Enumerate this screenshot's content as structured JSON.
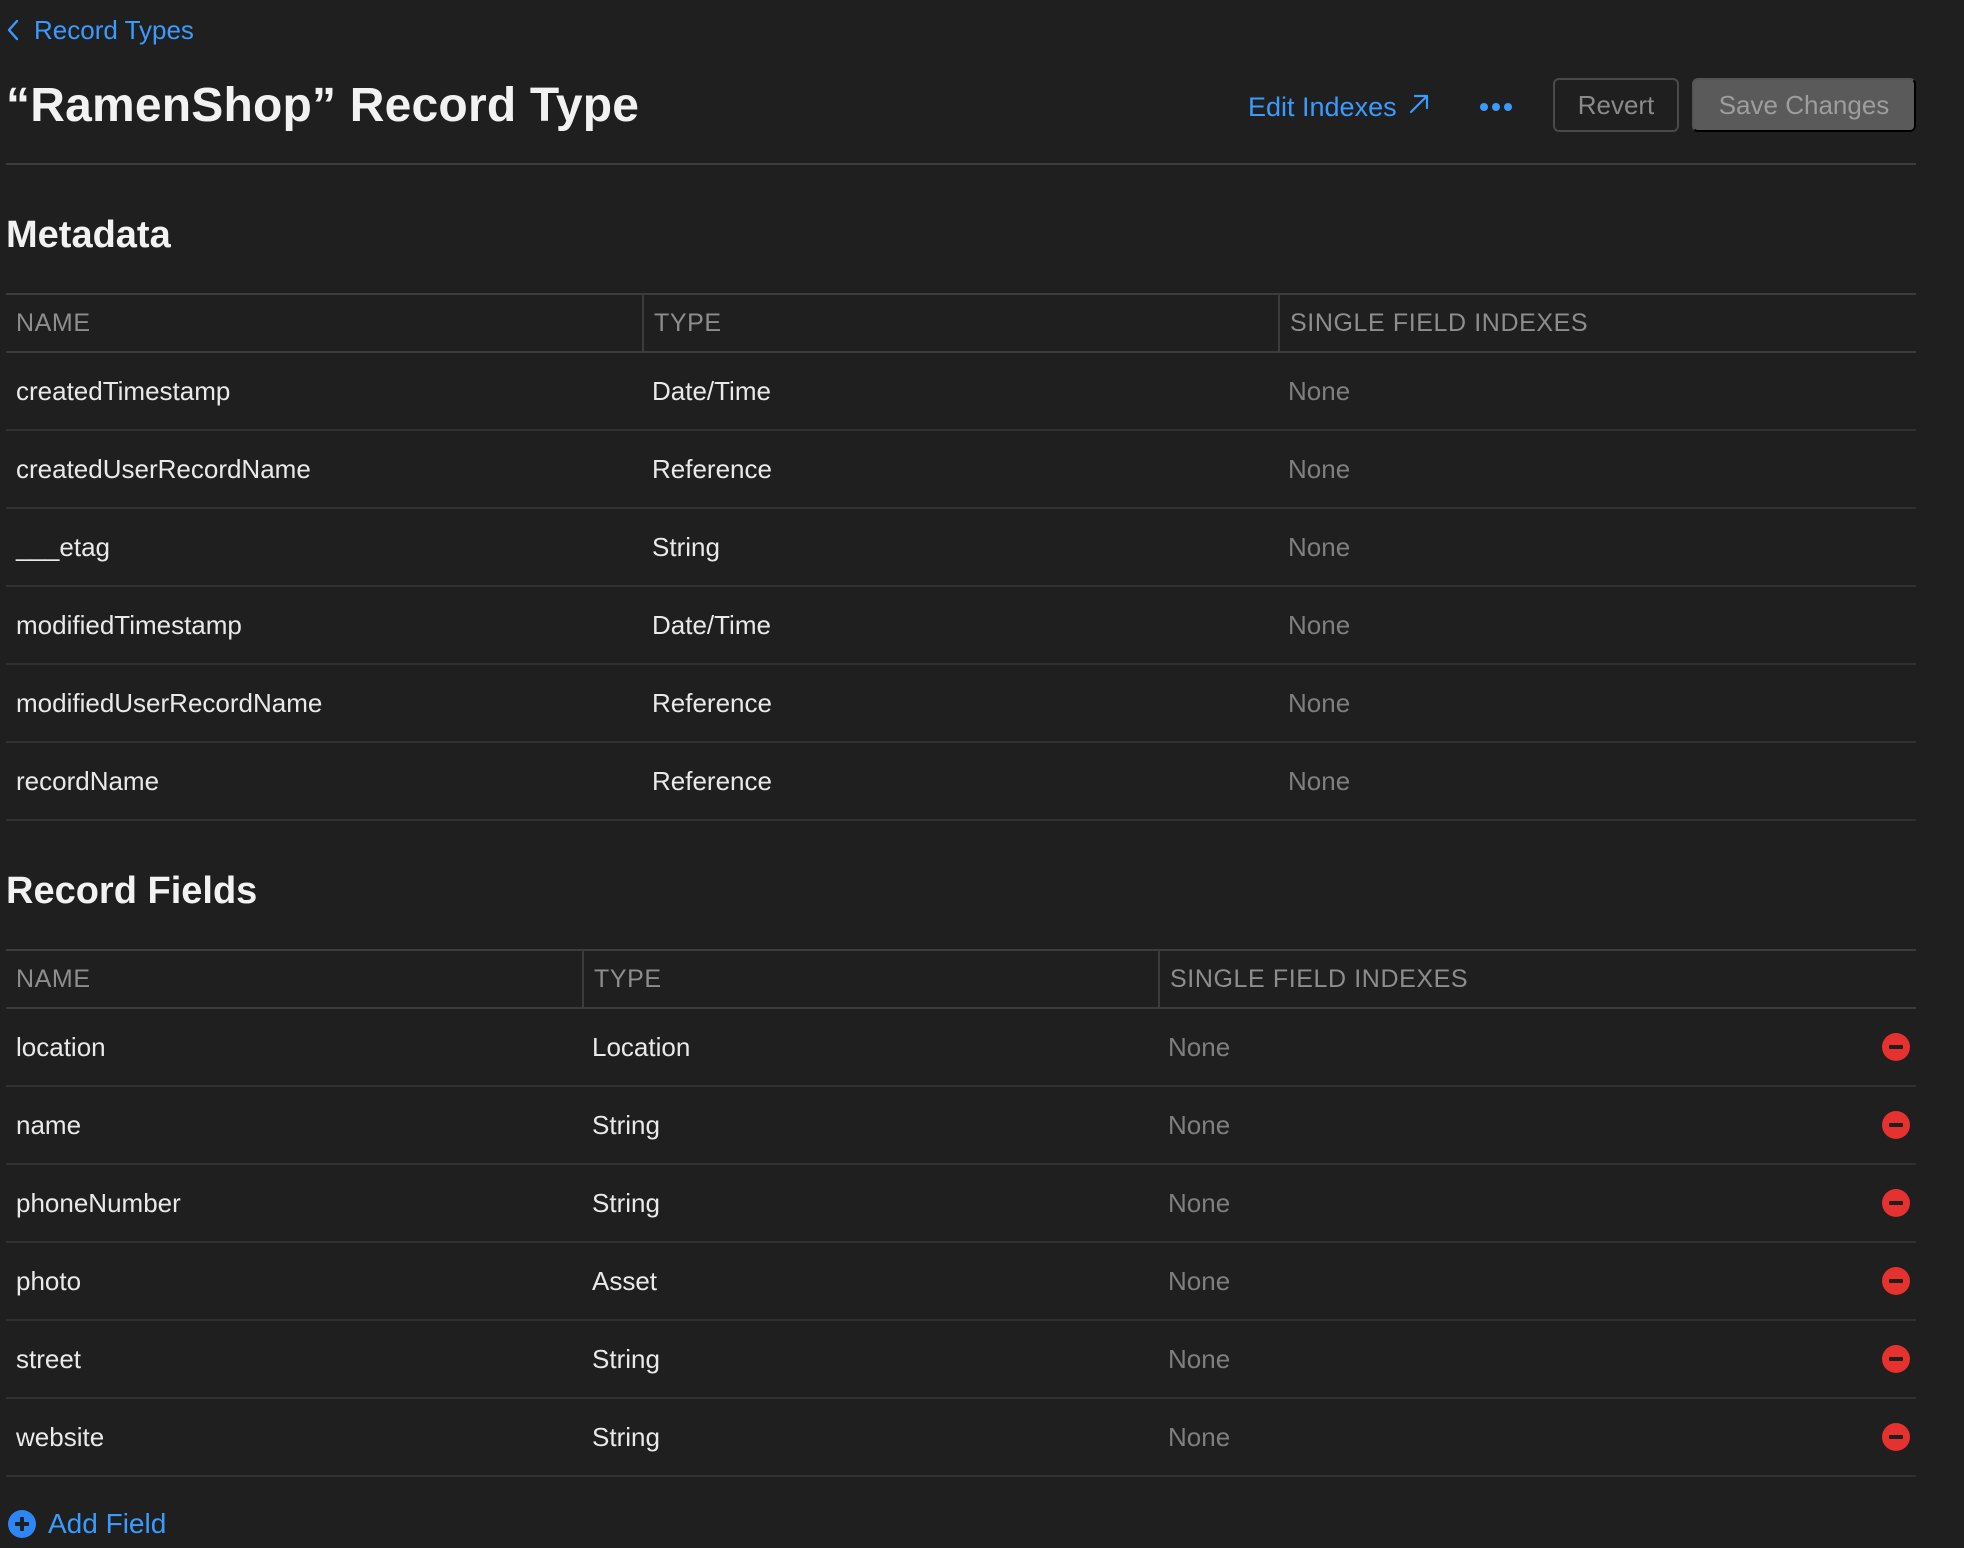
{
  "breadcrumb": {
    "icon": "chevron-left-icon",
    "label": "Record Types"
  },
  "header": {
    "title": "“RamenShop” Record Type",
    "edit_indexes_label": "Edit Indexes",
    "edit_indexes_icon": "arrow-up-right-icon",
    "more_icon": "ellipsis-icon",
    "revert_label": "Revert",
    "save_label": "Save Changes"
  },
  "metadata": {
    "title": "Metadata",
    "columns": [
      "NAME",
      "TYPE",
      "SINGLE FIELD INDEXES"
    ],
    "rows": [
      {
        "name": "createdTimestamp",
        "type": "Date/Time",
        "indexes": "None"
      },
      {
        "name": "createdUserRecordName",
        "type": "Reference",
        "indexes": "None"
      },
      {
        "name": "___etag",
        "type": "String",
        "indexes": "None"
      },
      {
        "name": "modifiedTimestamp",
        "type": "Date/Time",
        "indexes": "None"
      },
      {
        "name": "modifiedUserRecordName",
        "type": "Reference",
        "indexes": "None"
      },
      {
        "name": "recordName",
        "type": "Reference",
        "indexes": "None"
      }
    ]
  },
  "record_fields": {
    "title": "Record Fields",
    "columns": [
      "NAME",
      "TYPE",
      "SINGLE FIELD INDEXES"
    ],
    "rows": [
      {
        "name": "location",
        "type": "Location",
        "indexes": "None"
      },
      {
        "name": "name",
        "type": "String",
        "indexes": "None"
      },
      {
        "name": "phoneNumber",
        "type": "String",
        "indexes": "None"
      },
      {
        "name": "photo",
        "type": "Asset",
        "indexes": "None"
      },
      {
        "name": "street",
        "type": "String",
        "indexes": "None"
      },
      {
        "name": "website",
        "type": "String",
        "indexes": "None"
      }
    ],
    "remove_icon": "minus-circle-icon"
  },
  "add_field": {
    "icon": "plus-circle-icon",
    "label": "Add Field"
  },
  "colors": {
    "background": "#1f1f1f",
    "accent": "#3a9bff",
    "destructive": "#e5322f",
    "muted_text": "#7f7f7f"
  }
}
